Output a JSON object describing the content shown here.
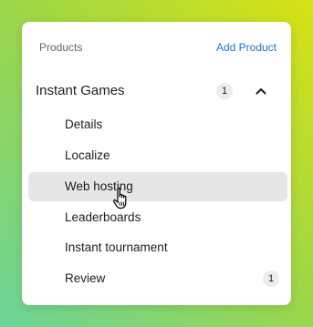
{
  "header": {
    "title": "Products",
    "action_label": "Add Product"
  },
  "group": {
    "label": "Instant Games",
    "count": "1",
    "expanded": true
  },
  "items": [
    {
      "label": "Details",
      "active": false
    },
    {
      "label": "Localize",
      "active": false
    },
    {
      "label": "Web hosting",
      "active": true
    },
    {
      "label": "Leaderboards",
      "active": false
    },
    {
      "label": "Instant tournament",
      "active": false
    },
    {
      "label": "Review",
      "active": false,
      "count": "1"
    }
  ],
  "colors": {
    "accent": "#1a73d2",
    "active_item_bg": "#e6e6e6",
    "badge_bg": "#ececec",
    "background_gradient": [
      "#6bd39a",
      "#9bd64a",
      "#d7e214"
    ]
  },
  "icons": {
    "group_toggle": "chevron-up-icon",
    "pointer": "hand-pointer-icon"
  }
}
